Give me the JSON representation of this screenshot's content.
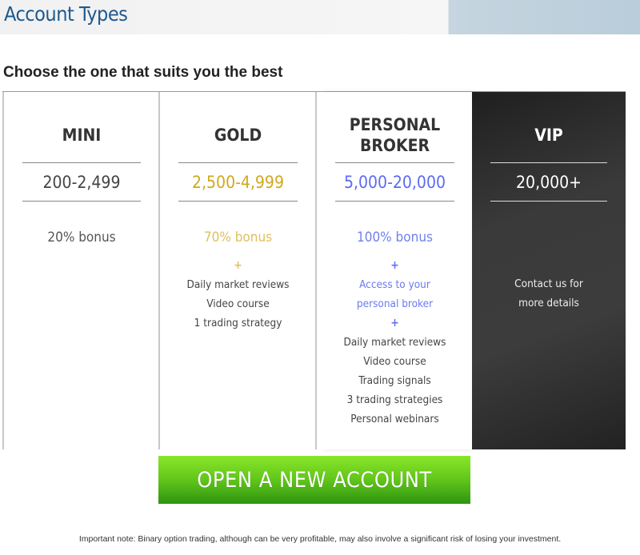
{
  "header": {
    "title": "Account Types"
  },
  "subtitle": "Choose the one that suits you the best",
  "colors": {
    "gold": "#d4b030",
    "blue": "#5b6cf0",
    "mini": "#444444",
    "vip_bg": "#333333",
    "button": "#5cc41a",
    "title": "#1e5a8e"
  },
  "plans": [
    {
      "name": "MINI",
      "range": "200-2,499",
      "bonus": "20% bonus",
      "features": []
    },
    {
      "name": "GOLD",
      "range": "2,500-4,999",
      "bonus": "70% bonus",
      "plus": "+",
      "features": [
        "Daily market reviews",
        "Video course",
        "1 trading strategy"
      ]
    },
    {
      "name_line1": "PERSONAL",
      "name_line2": "BROKER",
      "range": "5,000-20,000",
      "bonus": "100% bonus",
      "plus": "+",
      "highlight": [
        "Access to your",
        "personal broker"
      ],
      "features": [
        "Daily market reviews",
        "Video course",
        "Trading signals",
        "3 trading strategies",
        "Personal webinars"
      ]
    },
    {
      "name": "VIP",
      "range": "20,000+",
      "contact": [
        "Contact us for",
        "more details"
      ]
    }
  ],
  "button": {
    "label": "OPEN A NEW ACCOUNT"
  },
  "note": "Important note: Binary option trading, although can be very profitable, may also involve a significant risk of losing your investment."
}
